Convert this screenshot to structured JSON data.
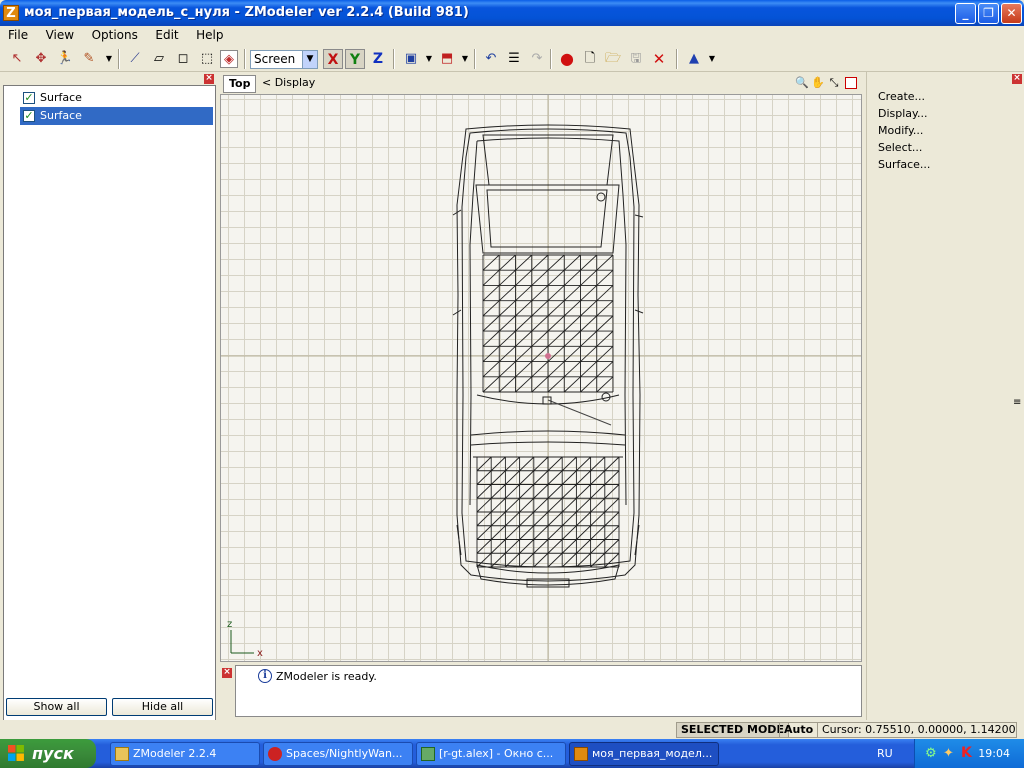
{
  "window": {
    "title": "моя_первая_модель_с_нуля - ZModeler ver 2.2.4 (Build 981)",
    "app_icon_letter": "Z",
    "minimize": "_",
    "maximize": "❐",
    "close": "✕"
  },
  "menu": [
    "File",
    "View",
    "Options",
    "Edit",
    "Help"
  ],
  "toolbar": {
    "coord_system": "Screen",
    "axes": [
      "X",
      "Y",
      "Z"
    ],
    "icons": [
      "select-pointer-icon",
      "move-icon",
      "walk-icon",
      "paint-icon",
      "vertex-icon",
      "face-icon",
      "box-icon",
      "cube-icon",
      "object-icon",
      "render-icon",
      "export-icon",
      "import-icon",
      "undo-icon",
      "notes-icon",
      "redo-icon",
      "record-icon",
      "new-file-icon",
      "open-folder-icon",
      "save-icon",
      "delete-icon",
      "cone-icon"
    ]
  },
  "left_panel": {
    "items": [
      {
        "label": "Surface",
        "checked": true,
        "selected": false
      },
      {
        "label": "Surface",
        "checked": true,
        "selected": true
      }
    ],
    "show_all": "Show all",
    "hide_all": "Hide all"
  },
  "viewport": {
    "tab": "Top",
    "display": "< Display",
    "axis_z": "z",
    "axis_x": "x"
  },
  "log": {
    "message": "ZModeler is ready."
  },
  "right_panel": {
    "commands": [
      "Create...",
      "Display...",
      "Modify...",
      "Select...",
      "Surface..."
    ]
  },
  "status": {
    "mode": "SELECTED MODE",
    "auto": "Auto",
    "cursor": "Cursor: 0.75510, 0.00000, 1.14200"
  },
  "taskbar": {
    "start": "пуск",
    "tasks": [
      {
        "label": "ZModeler 2.2.4",
        "active": false
      },
      {
        "label": "Spaces/NightlyWan...",
        "active": false
      },
      {
        "label": "[r-gt.alex] - Окно с...",
        "active": false
      },
      {
        "label": "моя_первая_модел...",
        "active": true
      }
    ],
    "lang": "RU",
    "clock": "19:04"
  },
  "colors": {
    "title_blue": "#0453d6",
    "selection": "#316ac5",
    "start_green": "#3a8a3a"
  }
}
